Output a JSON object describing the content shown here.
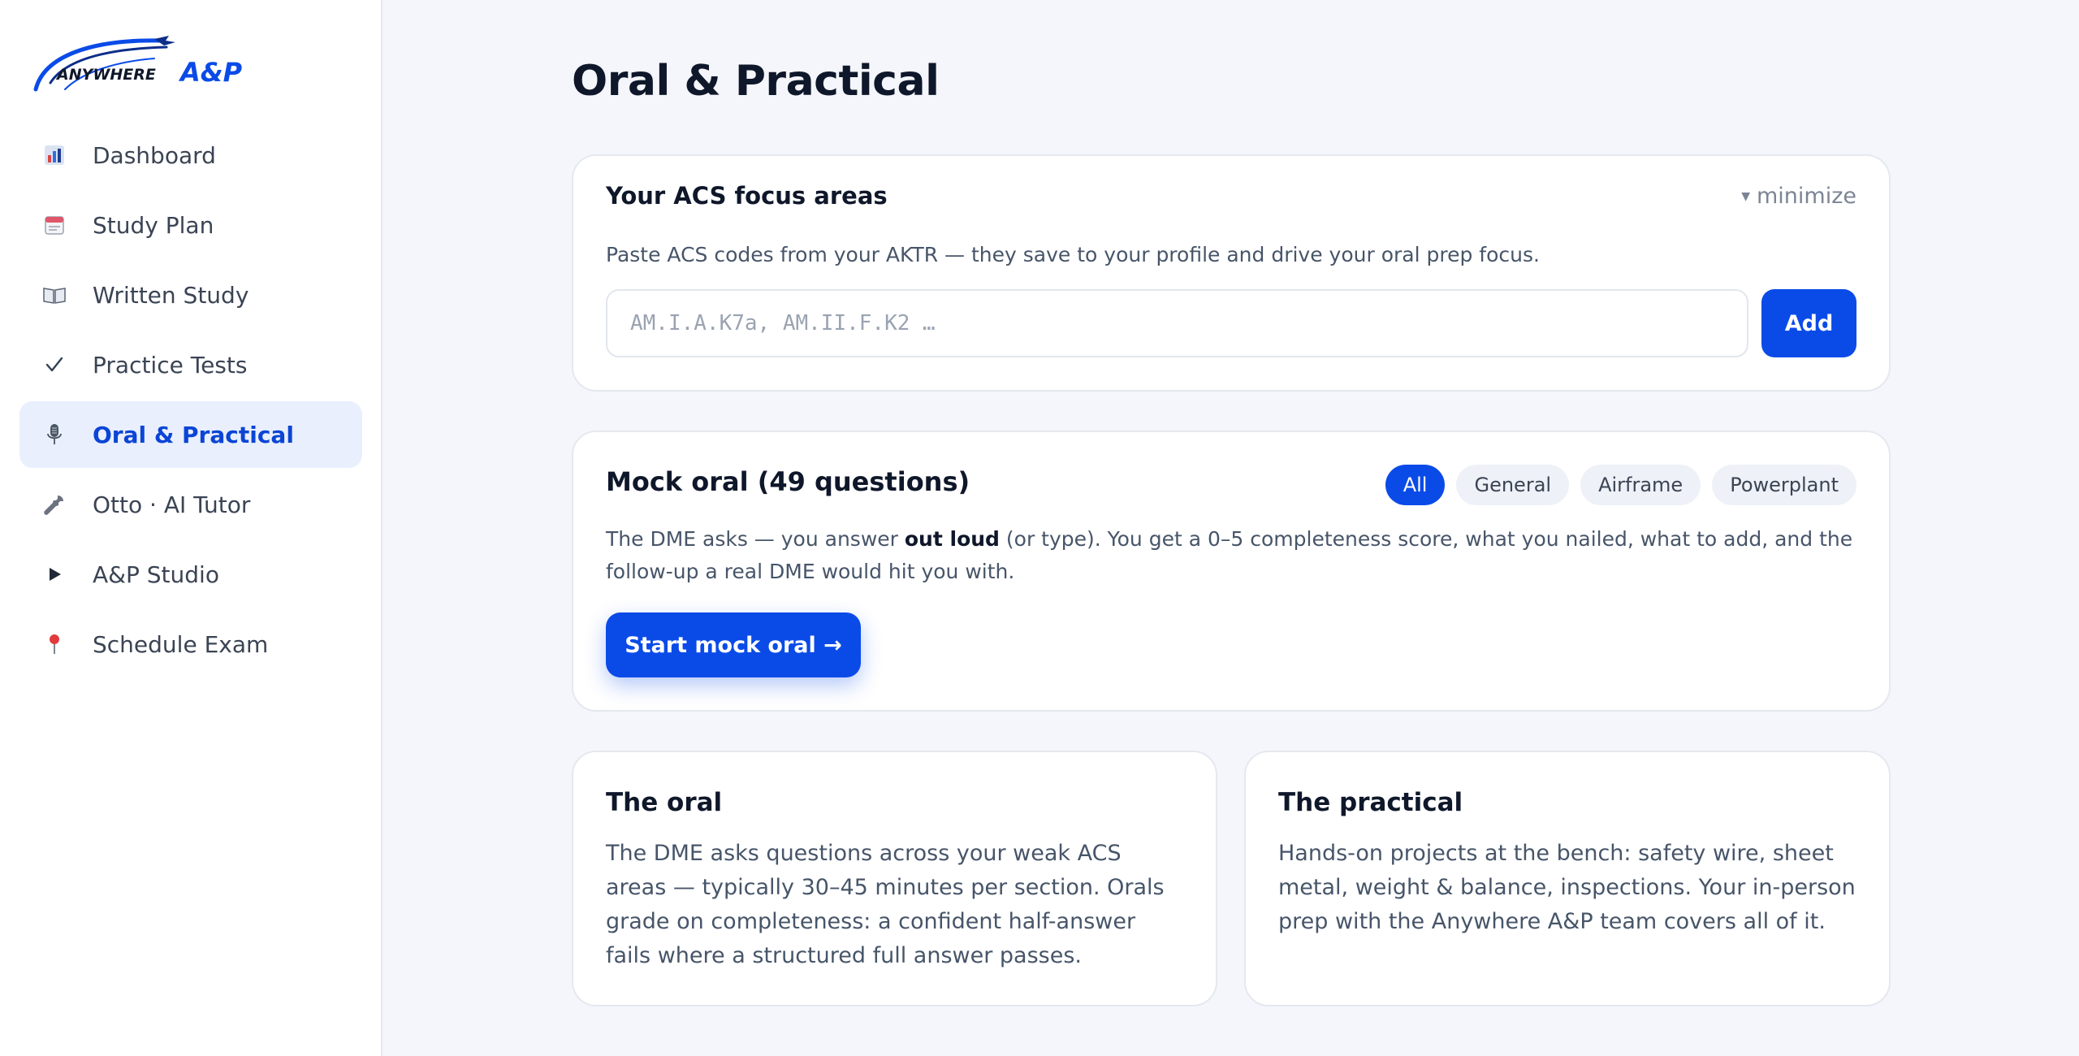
{
  "brand": {
    "logo_text_1": "ANYWHERE",
    "logo_text_2": "A&P",
    "color": "#0a4be8"
  },
  "sidebar": {
    "items": [
      {
        "label": "Dashboard",
        "icon": "bar-chart-icon",
        "active": false
      },
      {
        "label": "Study Plan",
        "icon": "calendar-icon",
        "active": false
      },
      {
        "label": "Written Study",
        "icon": "open-book-icon",
        "active": false
      },
      {
        "label": "Practice Tests",
        "icon": "checkmark-icon",
        "active": false
      },
      {
        "label": "Oral & Practical",
        "icon": "microphone-icon",
        "active": true
      },
      {
        "label": "Otto · AI Tutor",
        "icon": "wrench-icon",
        "active": false
      },
      {
        "label": "A&P Studio",
        "icon": "play-icon",
        "active": false
      },
      {
        "label": "Schedule Exam",
        "icon": "location-pin-icon",
        "active": false
      }
    ]
  },
  "main": {
    "title": "Oral & Practical",
    "focus_card": {
      "title": "Your ACS focus areas",
      "minimize_label": "minimize",
      "description": "Paste ACS codes from your AKTR — they save to your profile and drive your oral prep focus.",
      "input_placeholder": "AM.I.A.K7a, AM.II.F.K2 …",
      "input_value": "",
      "add_label": "Add"
    },
    "mock_card": {
      "title": "Mock oral (49 questions)",
      "filters": [
        {
          "label": "All",
          "active": true
        },
        {
          "label": "General",
          "active": false
        },
        {
          "label": "Airframe",
          "active": false
        },
        {
          "label": "Powerplant",
          "active": false
        }
      ],
      "description_before": "The DME asks — you answer ",
      "description_bold": "out loud",
      "description_after": " (or type). You get a 0–5 completeness score, what you nailed, what to add, and the follow-up a real DME would hit you with.",
      "start_label": "Start mock oral →"
    },
    "oral_card": {
      "title": "The oral",
      "description": "The DME asks questions across your weak ACS areas — typically 30–45 minutes per section. Orals grade on completeness: a confident half-answer fails where a structured full answer passes."
    },
    "practical_card": {
      "title": "The practical",
      "description": "Hands-on projects at the bench: safety wire, sheet metal, weight & balance, inspections. Your in-person prep with the Anywhere A&P team covers all of it."
    }
  }
}
